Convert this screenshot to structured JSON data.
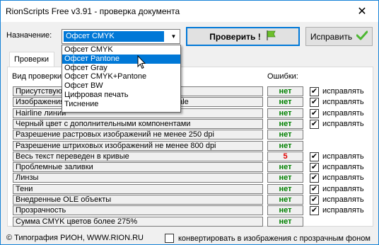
{
  "window": {
    "title": "RionScripts Free v3.91 - проверка документа",
    "close": "✕"
  },
  "toolbar": {
    "purpose_label": "Назначение:",
    "purpose_value": "Офсет CMYK",
    "check_label": "Проверить !",
    "fix_label": "Исправить"
  },
  "tabs": [
    {
      "label": "Проверки"
    }
  ],
  "headers": {
    "checks": "Вид проверки",
    "errors": "Ошибки:"
  },
  "rows": [
    {
      "label": "Присутствуют ненужные элементы",
      "result": "нет",
      "fix": "исправлять",
      "has_fix": true
    },
    {
      "label": "Изображения не в режиме CMYK или Grayscale",
      "result": "нет",
      "fix": "исправлять",
      "has_fix": true
    },
    {
      "label": "Hairline линии",
      "result": "нет",
      "fix": "исправлять",
      "has_fix": true
    },
    {
      "label": "Черный цвет с дополнительными компонентами",
      "result": "нет",
      "fix": "исправлять",
      "has_fix": true
    },
    {
      "label": "Разрешение растровых изображений не менее 250 dpi",
      "result": "нет",
      "fix": "",
      "has_fix": false
    },
    {
      "label": "Разрешение штриховых изображений не менее 800 dpi",
      "result": "нет",
      "fix": "",
      "has_fix": false
    },
    {
      "label": "Весь текст переведен в кривые",
      "result": "5",
      "fix": "исправлять",
      "has_fix": true
    },
    {
      "label": "Проблемные заливки",
      "result": "нет",
      "fix": "исправлять",
      "has_fix": true
    },
    {
      "label": "Линзы",
      "result": "нет",
      "fix": "исправлять",
      "has_fix": true
    },
    {
      "label": "Тени",
      "result": "нет",
      "fix": "исправлять",
      "has_fix": true
    },
    {
      "label": "Внедренные OLE объекты",
      "result": "нет",
      "fix": "исправлять",
      "has_fix": true
    },
    {
      "label": "Прозрачность",
      "result": "нет",
      "fix": "исправлять",
      "has_fix": true
    },
    {
      "label": "Сумма CMYK цветов более 275%",
      "result": "нет",
      "fix": "",
      "has_fix": false
    }
  ],
  "dropdown": {
    "items": [
      "Офсет CMYK",
      "Офсет Pantone",
      "Офсет Gray",
      "Офсет CMYK+Pantone",
      "Офсет BW",
      "Цифровая печать",
      "Тиснение"
    ],
    "highlighted_index": 1
  },
  "footer": {
    "copyright": "© Типография РИОН,  WWW.RION.RU",
    "convert_label": "конвертировать в изображения с прозрачным фоном"
  },
  "colors": {
    "accent": "#0078d7",
    "ok": "#008000",
    "error": "#e00000",
    "flag": "#6dbf2a"
  }
}
